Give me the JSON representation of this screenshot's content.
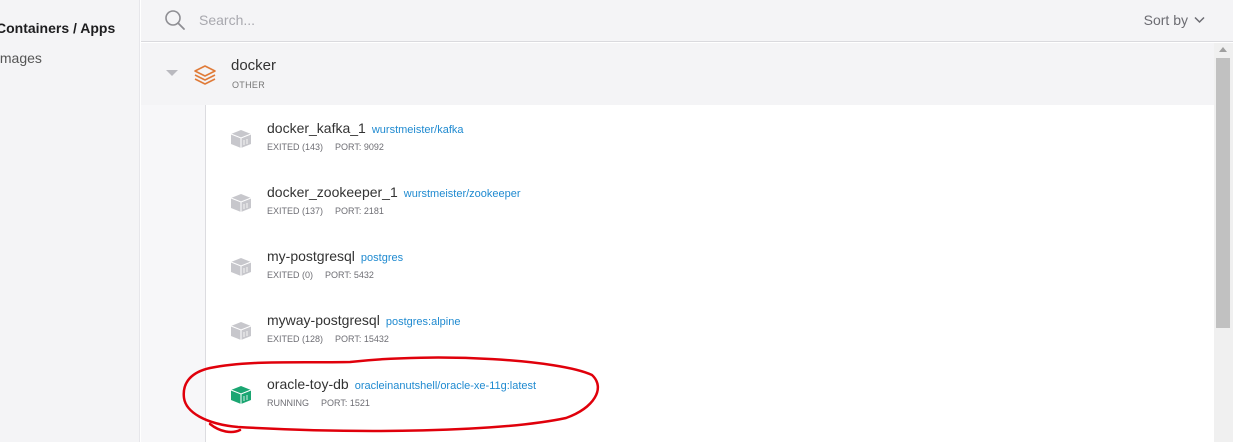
{
  "sidebar": {
    "items": [
      {
        "label": "Containers / Apps"
      },
      {
        "label": "Images"
      }
    ]
  },
  "search": {
    "placeholder": "Search..."
  },
  "sort": {
    "label": "Sort by"
  },
  "group": {
    "name": "docker",
    "type": "OTHER"
  },
  "containers": [
    {
      "name": "docker_kafka_1",
      "image": "wurstmeister/kafka",
      "status": "EXITED (143)",
      "port": "PORT: 9092",
      "state_color": "#c7c7cc"
    },
    {
      "name": "docker_zookeeper_1",
      "image": "wurstmeister/zookeeper",
      "status": "EXITED (137)",
      "port": "PORT: 2181",
      "state_color": "#c7c7cc"
    },
    {
      "name": "my-postgresql",
      "image": "postgres",
      "status": "EXITED (0)",
      "port": "PORT: 5432",
      "state_color": "#c7c7cc"
    },
    {
      "name": "myway-postgresql",
      "image": "postgres:alpine",
      "status": "EXITED (128)",
      "port": "PORT: 15432",
      "state_color": "#c7c7cc"
    },
    {
      "name": "oracle-toy-db",
      "image": "oracleinanutshell/oracle-xe-11g:latest",
      "status": "RUNNING",
      "port": "PORT: 1521",
      "state_color": "#1ba672"
    }
  ],
  "colors": {
    "link": "#1f8ad0",
    "running": "#1ba672",
    "exited": "#c7c7cc",
    "stack_icon": "#e07b39",
    "annotation": "#e0000b"
  }
}
